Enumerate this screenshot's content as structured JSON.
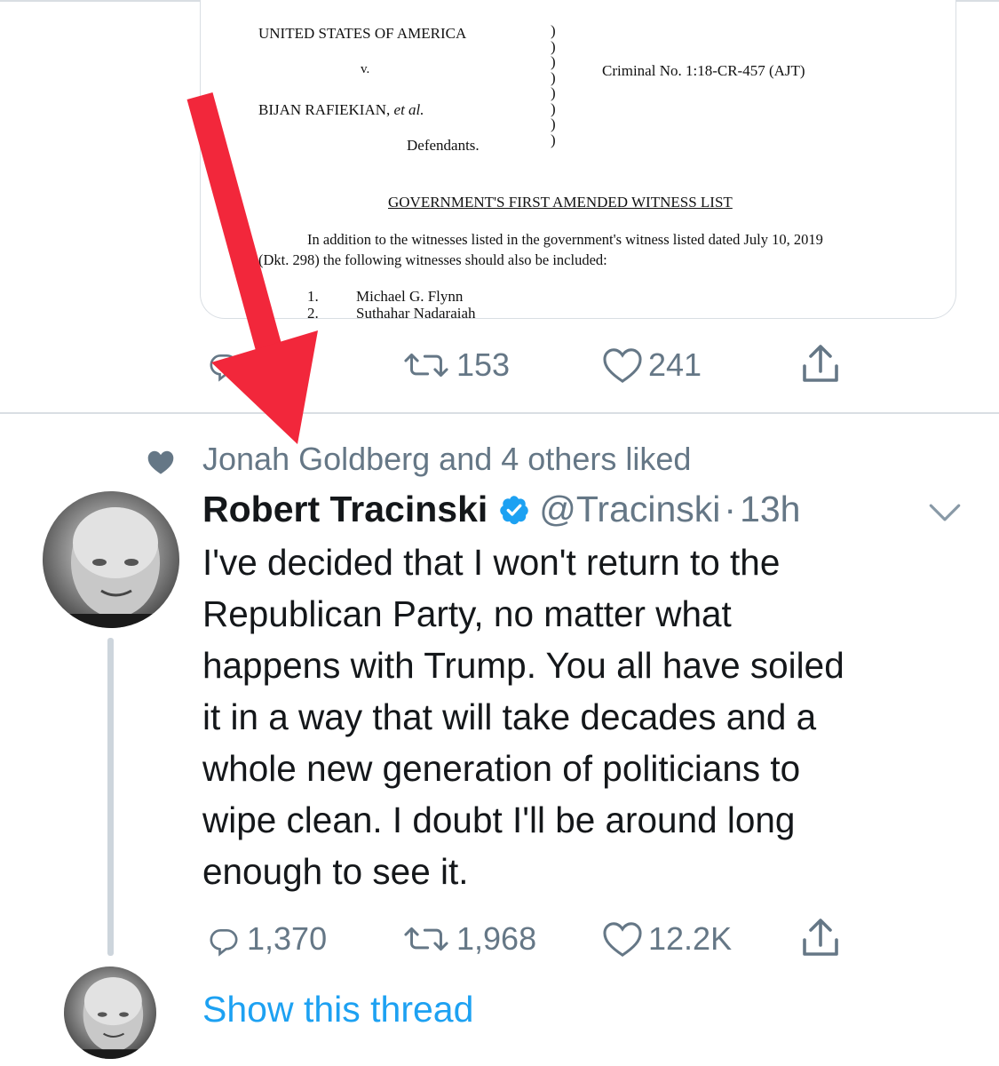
{
  "document": {
    "caption_left": "UNITED STATES OF AMERICA",
    "versus": "v.",
    "case_number": "Criminal No. 1:18-CR-457 (AJT)",
    "defendant": "BIJAN RAFIEKIAN,",
    "et_al": "et al.",
    "defendants_label": "Defendants.",
    "title": "GOVERNMENT'S FIRST AMENDED WITNESS LIST",
    "body_line1": "In addition to the witnesses listed in the government's witness listed dated July 10, 2019",
    "body_line2": "(Dkt. 298) the following witnesses should also be included:",
    "witnesses": [
      {
        "num": "1.",
        "name": "Michael G. Flynn"
      },
      {
        "num": "2.",
        "name": "Suthahar Nadaraiah"
      }
    ]
  },
  "first_tweet_actions": {
    "reply_count": "",
    "retweet_count": "153",
    "like_count": "241"
  },
  "second_tweet": {
    "social_context": "Jonah Goldberg and 4 others liked",
    "author_name": "Robert Tracinski",
    "handle": "@Tracinski",
    "separator": "·",
    "time": "13h",
    "verified": true,
    "text_lines": [
      "I've decided that I won't return to the",
      "Republican Party, no matter what",
      "happens with Trump. You all have soiled",
      "it in a way that will take decades and a",
      "whole new generation of politicians to",
      "wipe clean. I doubt I'll be around long",
      "enough to see it."
    ],
    "reply_count": "1,370",
    "retweet_count": "1,968",
    "like_count": "12.2K",
    "show_thread": "Show this thread"
  },
  "colors": {
    "link": "#1da1f2",
    "muted": "#657786",
    "arrow": "#f2273b",
    "verified": "#1da1f2"
  },
  "icons": [
    "reply-icon",
    "retweet-icon",
    "like-icon",
    "share-icon",
    "verified-badge-icon",
    "chevron-down-icon",
    "heart-social-icon"
  ]
}
